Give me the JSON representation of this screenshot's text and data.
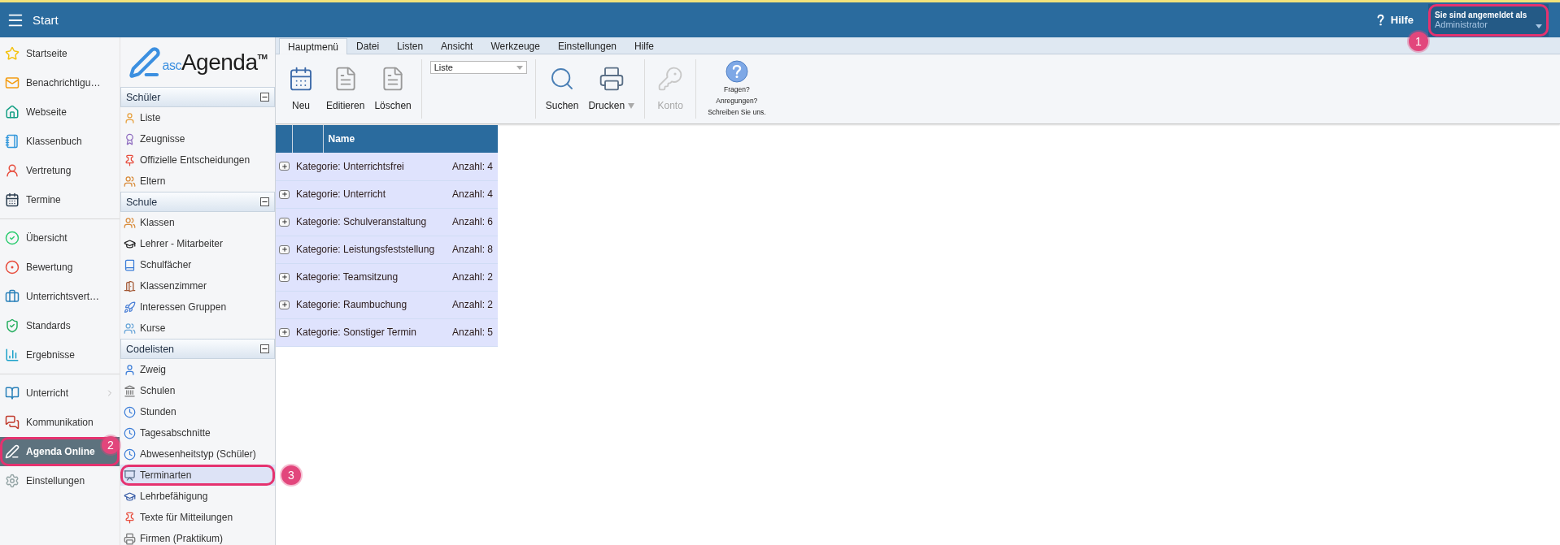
{
  "header": {
    "title": "Start",
    "help": "Hilfe",
    "account": {
      "caption": "Sie sind angemeldet als",
      "user": "Administrator",
      "annotation": "1"
    }
  },
  "sidebar": {
    "groups": [
      {
        "items": [
          {
            "label": "Startseite",
            "selected": false,
            "submenu": false
          },
          {
            "label": "Benachrichtigu…",
            "selected": false,
            "submenu": false
          },
          {
            "label": "Webseite",
            "selected": false,
            "submenu": false
          },
          {
            "label": "Klassenbuch",
            "selected": false,
            "submenu": false
          },
          {
            "label": "Vertretung",
            "selected": false,
            "submenu": false
          },
          {
            "label": "Termine",
            "selected": false,
            "submenu": false
          }
        ]
      },
      {
        "items": [
          {
            "label": "Übersicht",
            "selected": false,
            "submenu": false
          },
          {
            "label": "Bewertung",
            "selected": false,
            "submenu": false
          },
          {
            "label": "Unterrichtsvert…",
            "selected": false,
            "submenu": false
          },
          {
            "label": "Standards",
            "selected": false,
            "submenu": false
          },
          {
            "label": "Ergebnisse",
            "selected": false,
            "submenu": false
          }
        ]
      },
      {
        "items": [
          {
            "label": "Unterricht",
            "selected": false,
            "submenu": true
          },
          {
            "label": "Kommunikation",
            "selected": false,
            "submenu": false
          },
          {
            "label": "Agenda Online",
            "selected": true,
            "submenu": false,
            "annotation": "2"
          },
          {
            "label": "Einstellungen",
            "selected": false,
            "submenu": false
          }
        ]
      }
    ]
  },
  "logo": {
    "prefix": "asc",
    "name": "Agenda",
    "mark": "TM"
  },
  "nav": {
    "sections": [
      {
        "title": "Schüler",
        "expanded": true,
        "items": [
          {
            "label": "Liste",
            "selected": false
          },
          {
            "label": "Zeugnisse",
            "selected": false
          },
          {
            "label": "Offizielle Entscheidungen",
            "selected": false
          },
          {
            "label": "Eltern",
            "selected": false
          }
        ]
      },
      {
        "title": "Schule",
        "expanded": true,
        "items": [
          {
            "label": "Klassen",
            "selected": false
          },
          {
            "label": "Lehrer - Mitarbeiter",
            "selected": false
          },
          {
            "label": "Schulfächer",
            "selected": false
          },
          {
            "label": "Klassenzimmer",
            "selected": false
          },
          {
            "label": "Interessen Gruppen",
            "selected": false
          },
          {
            "label": "Kurse",
            "selected": false
          }
        ]
      },
      {
        "title": "Codelisten",
        "expanded": true,
        "items": [
          {
            "label": "Zweig",
            "selected": false
          },
          {
            "label": "Schulen",
            "selected": false
          },
          {
            "label": "Stunden",
            "selected": false
          },
          {
            "label": "Tagesabschnitte",
            "selected": false
          },
          {
            "label": "Abwesenheitstyp (Schüler)",
            "selected": false
          },
          {
            "label": "Terminarten",
            "selected": true,
            "annotation": "3"
          },
          {
            "label": "Lehrbefähigung",
            "selected": false
          },
          {
            "label": "Texte für Mitteilungen",
            "selected": false
          },
          {
            "label": "Firmen (Praktikum)",
            "selected": false
          }
        ]
      }
    ]
  },
  "ribbon": {
    "tabs": [
      {
        "label": "Hauptmenü",
        "selected": true
      },
      {
        "label": "Datei",
        "selected": false
      },
      {
        "label": "Listen",
        "selected": false
      },
      {
        "label": "Ansicht",
        "selected": false
      },
      {
        "label": "Werkzeuge",
        "selected": false
      },
      {
        "label": "Einstellungen",
        "selected": false
      },
      {
        "label": "Hilfe",
        "selected": false
      }
    ],
    "groups": [
      {
        "kind": "buttons",
        "buttons": [
          {
            "label": "Neu",
            "disabled": false,
            "dropdown": false
          },
          {
            "label": "Editieren",
            "disabled": false,
            "dropdown": false
          },
          {
            "label": "Löschen",
            "disabled": false,
            "dropdown": false
          }
        ]
      },
      {
        "kind": "select",
        "value": "Liste"
      },
      {
        "kind": "buttons",
        "buttons": [
          {
            "label": "Suchen",
            "disabled": false,
            "dropdown": false
          },
          {
            "label": "Drucken",
            "disabled": false,
            "dropdown": true
          }
        ]
      },
      {
        "kind": "buttons",
        "buttons": [
          {
            "label": "Konto",
            "disabled": true,
            "dropdown": false
          }
        ]
      },
      {
        "kind": "feedback",
        "lines": [
          "Fragen?",
          "Anregungen?",
          "Schreiben Sie uns."
        ]
      }
    ]
  },
  "table": {
    "columns": [
      "Name"
    ],
    "rows": [
      {
        "name": "Kategorie: Unterrichtsfrei",
        "count": "Anzahl: 4",
        "expanded": false
      },
      {
        "name": "Kategorie: Unterricht",
        "count": "Anzahl: 4",
        "expanded": false
      },
      {
        "name": "Kategorie: Schulveranstaltung",
        "count": "Anzahl: 6",
        "expanded": false
      },
      {
        "name": "Kategorie: Leistungsfeststellung",
        "count": "Anzahl: 8",
        "expanded": false
      },
      {
        "name": "Kategorie: Teamsitzung",
        "count": "Anzahl: 2",
        "expanded": false
      },
      {
        "name": "Kategorie: Raumbuchung",
        "count": "Anzahl: 2",
        "expanded": false
      },
      {
        "name": "Kategorie: Sonstiger Termin",
        "count": "Anzahl: 5",
        "expanded": false
      }
    ]
  }
}
